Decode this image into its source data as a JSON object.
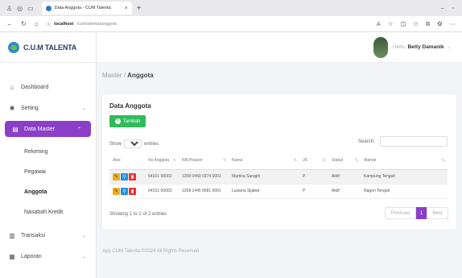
{
  "browser": {
    "tab_title": "Data Anggota - CUM Talenta",
    "url_host": "localhost",
    "url_path": "/cumtalenta/anggota"
  },
  "brand": {
    "name": "C.U.M TALENTA"
  },
  "sidebar": {
    "items": [
      {
        "label": "Dashboard",
        "icon": "home-icon"
      },
      {
        "label": "Setting",
        "icon": "gear-icon"
      },
      {
        "label": "Data Master",
        "icon": "database-icon"
      },
      {
        "label": "Transaksi",
        "icon": "document-icon"
      },
      {
        "label": "Laporan",
        "icon": "report-icon"
      }
    ],
    "submenu": [
      "Rekening",
      "Pegawai",
      "Anggota",
      "Nasabah Kredit"
    ]
  },
  "header": {
    "hello": "Hello,",
    "user": "Betty Damanik"
  },
  "breadcrumb": {
    "parent": "Master",
    "sep": "/",
    "current": "Anggota"
  },
  "card": {
    "title": "Data Anggota",
    "add_label": "Tambah",
    "show_prefix": "Show",
    "show_value": "10",
    "show_suffix": "entries",
    "search_label": "Search:",
    "columns": [
      "Aksi",
      "No Anggota",
      "NIK/Paspor",
      "Nama",
      "JK",
      "Status",
      "Alamat"
    ],
    "rows": [
      {
        "no": "64101-00002",
        "nik": "1208 0450 0374 0001",
        "nama": "Martina Saragih",
        "jk": "P",
        "status": "Aktif",
        "alamat": "Kampung Tengah"
      },
      {
        "no": "64101-00003",
        "nik": "1208 1445 0581 0001",
        "nama": "Lusiana Sijabat",
        "jk": "P",
        "status": "Aktif",
        "alamat": "Nagori Tengah"
      }
    ],
    "info": "Showing 1 to 2 of 2 entries",
    "pager": {
      "prev": "Previous",
      "page": "1",
      "next": "Next"
    }
  },
  "footer": "App CUM Talenta ©2024 All Rights Reserved.",
  "colors": {
    "accent": "#8b3fc9",
    "success": "#2ebd59",
    "warning": "#f0ad1c",
    "info": "#1f8fe0",
    "danger": "#e63535"
  }
}
